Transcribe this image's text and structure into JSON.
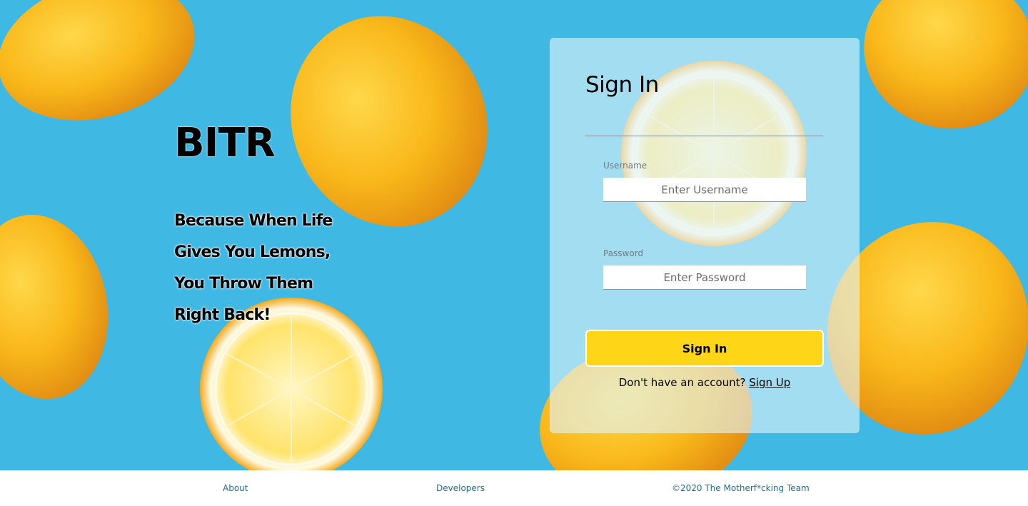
{
  "brand": {
    "name": "BITR"
  },
  "tagline": {
    "lines": [
      "Because When Life",
      "Gives You Lemons,",
      "You Throw Them",
      "Right Back!"
    ]
  },
  "signin_card": {
    "title": "Sign In",
    "username": {
      "label": "Username",
      "placeholder": "Enter Username",
      "value": ""
    },
    "password": {
      "label": "Password",
      "placeholder": "Enter Password",
      "value": ""
    },
    "submit_label": "Sign In",
    "signup_prompt": "Don't have an account?",
    "signup_link": "Sign Up"
  },
  "footer": {
    "about": "About",
    "developers": "Developers",
    "copyright": "©2020 The Motherf*cking Team"
  },
  "colors": {
    "background_blue": "#3fb8e3",
    "lemon_yellow": "#ffd617",
    "footer_link": "#1d6f9a"
  }
}
